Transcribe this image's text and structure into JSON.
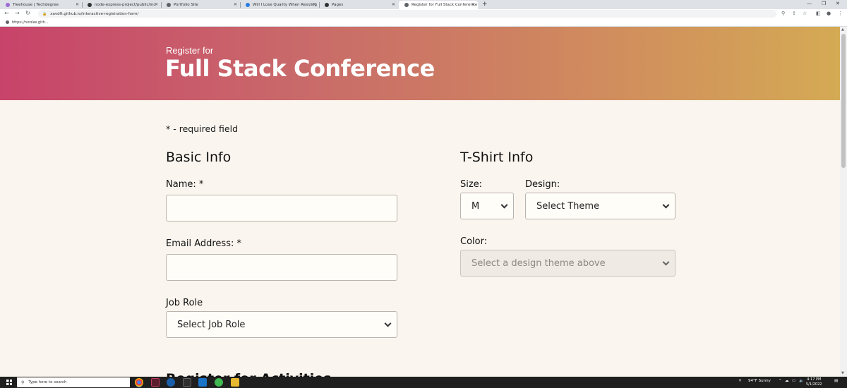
{
  "browser": {
    "tabs": [
      {
        "label": "Treehouse | Techdegree",
        "color": "#9b6bd6"
      },
      {
        "label": "node-express-project/public/inc",
        "color": "#333333"
      },
      {
        "label": "Portfolio Site",
        "color": "#5f6368"
      },
      {
        "label": "Will I Lose Quality When Resizing",
        "color": "#2a7de1"
      },
      {
        "label": "Pages",
        "color": "#333333"
      },
      {
        "label": "Register for Full Stack Conference",
        "color": "#5f6368"
      }
    ],
    "url": "xavdft.github.io/interactive-registration-form/",
    "bookmark": "https://nicolas.gith..."
  },
  "page": {
    "hero_pre": "Register for",
    "hero_title": "Full Stack Conference",
    "required_note": "* - required field",
    "basic_info": {
      "title": "Basic Info",
      "name_label": "Name: *",
      "email_label": "Email Address: *",
      "job_label": "Job Role",
      "job_value": "Select Job Role"
    },
    "tshirt_info": {
      "title": "T-Shirt Info",
      "size_label": "Size:",
      "size_value": "M",
      "design_label": "Design:",
      "design_value": "Select Theme",
      "color_label": "Color:",
      "color_value": "Select a design theme above"
    },
    "next_section": "Register for Activities"
  },
  "taskbar": {
    "search_placeholder": "Type here to search",
    "weather": "94°F  Sunny",
    "time": "4:17 PM",
    "date": "5/1/2022"
  },
  "colors": {
    "hero_start": "#c8436a",
    "hero_end": "#d4aa54",
    "page_bg": "#faf5ee"
  }
}
